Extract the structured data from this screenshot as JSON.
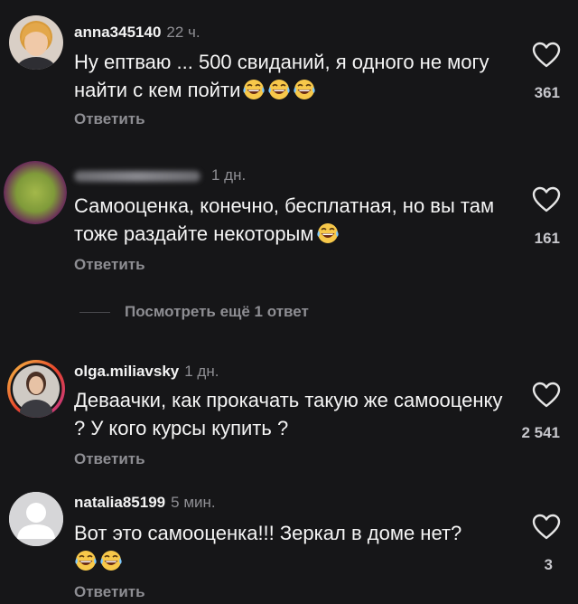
{
  "comments": [
    {
      "user": "anna345140",
      "time": "22 ч.",
      "text": "Ну ептваю ... 500 свиданий, я одного не могу найти с кем пойти",
      "emoji_count": 3,
      "likes": "361",
      "reply": "Ответить"
    },
    {
      "user": "",
      "time": "1 дн.",
      "text": "Самооценка, конечно, бесплатная, но вы там тоже раздайте некоторым",
      "emoji_count": 1,
      "likes": "161",
      "reply": "Ответить"
    },
    {
      "user": "olga.miliavsky",
      "time": "1 дн.",
      "text": "Деваачки, как прокачать такую же самооценку ? У кого курсы купить ?",
      "emoji_count": 0,
      "likes": "2 541",
      "reply": "Ответить"
    },
    {
      "user": "natalia85199",
      "time": "5 мин.",
      "text": "Вот это самооценка!!! Зеркал в доме нет?",
      "emoji_count": 2,
      "likes": "3",
      "reply": "Ответить"
    }
  ],
  "view_more": "Посмотреть ещё 1 ответ",
  "icons": {
    "like": "heart-icon",
    "emoji": "face-with-tears-of-joy"
  },
  "colors": {
    "background": "#161618",
    "muted": "#8e8e93"
  }
}
